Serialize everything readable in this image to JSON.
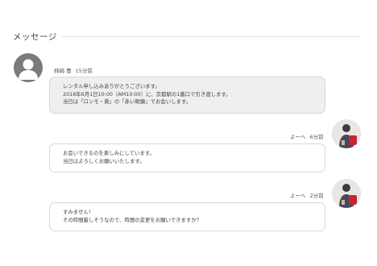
{
  "section": {
    "title": "メッセージ"
  },
  "messages": [
    {
      "sender": "柿崎 豊",
      "time": "15分前",
      "lines": [
        "レンタル申し込みありがとうございます。",
        "2018年6月1日10:00（AM10:00）に、京都駅の1番口で引き渡します。",
        "当日は「ロンモ・黄」の「赤い眼鏡」でお会いします。"
      ]
    },
    {
      "sender": "よーへ",
      "time": "6分前",
      "lines": [
        "お会いできるのを楽しみにしています。",
        "当日はよろしくお願いいたします。"
      ]
    },
    {
      "sender": "よーへ",
      "time": "2分前",
      "lines": [
        "すみません！",
        "その時間厳しそうなので、時間の変更をお願いできますか？"
      ]
    }
  ],
  "colors": {
    "incoming_bubble": "#efefef",
    "outgoing_bubble": "#ffffff",
    "default_avatar": "#7b7b7b"
  }
}
